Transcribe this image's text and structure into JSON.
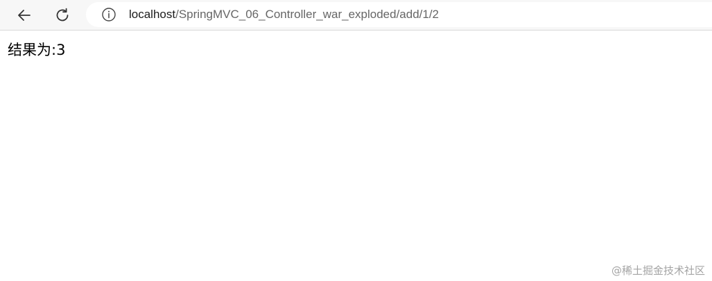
{
  "browser": {
    "back_icon": "back-arrow-icon",
    "reload_icon": "reload-icon",
    "info_icon": "info-icon",
    "url": {
      "host": "localhost",
      "path": "/SpringMVC_06_Controller_war_exploded/add/1/2"
    }
  },
  "page": {
    "result_text": "结果为:3"
  },
  "watermark": {
    "text": "@稀土掘金技术社区"
  },
  "colors": {
    "toolbar_bg": "#f7f7f7",
    "address_bg": "#ffffff",
    "icon_color": "#333333",
    "url_path_color": "#666666"
  }
}
